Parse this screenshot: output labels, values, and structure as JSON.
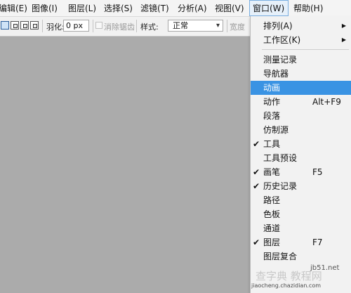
{
  "menubar": {
    "items": [
      "编辑(E)",
      "图像(I)",
      "图层(L)",
      "选择(S)",
      "滤镜(T)",
      "分析(A)",
      "视图(V)",
      "窗口(W)",
      "帮助(H)"
    ],
    "active_index": 7
  },
  "options_bar": {
    "feather_label": "羽化:",
    "feather_value": "0 px",
    "antialias_label": "消除锯齿",
    "style_label": "样式:",
    "style_value": "正常",
    "width_label": "宽度"
  },
  "window_menu": {
    "items": [
      {
        "label": "排列(A)",
        "submenu": true
      },
      {
        "label": "工作区(K)",
        "submenu": true
      },
      {
        "label": "测量记录"
      },
      {
        "label": "导航器"
      },
      {
        "label": "动画",
        "highlighted": true
      },
      {
        "label": "动作",
        "shortcut": "Alt+F9"
      },
      {
        "label": "段落"
      },
      {
        "label": "仿制源"
      },
      {
        "label": "工具",
        "checked": true
      },
      {
        "label": "工具预设"
      },
      {
        "label": "画笔",
        "shortcut": "F5",
        "checked": true
      },
      {
        "label": "历史记录",
        "checked": true
      },
      {
        "label": "路径"
      },
      {
        "label": "色板"
      },
      {
        "label": "通道"
      },
      {
        "label": "图层",
        "shortcut": "F7",
        "checked": true
      },
      {
        "label": "图层复合"
      }
    ],
    "highlight_color": "#3a93e3"
  },
  "watermark": {
    "site": "jb51.net",
    "brand": "查字典 教程网",
    "url": "jiaocheng.chazidian.com"
  }
}
